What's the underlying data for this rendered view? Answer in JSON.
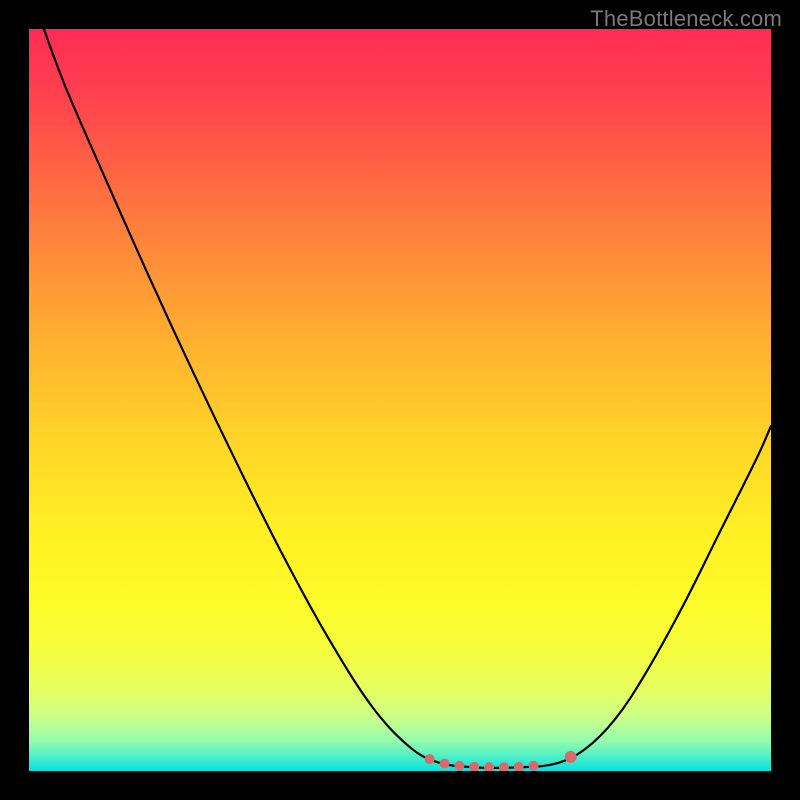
{
  "attribution": "TheBottleneck.com",
  "chart_data": {
    "type": "line",
    "title": "",
    "xlabel": "",
    "ylabel": "",
    "xlim": [
      0,
      100
    ],
    "ylim": [
      0,
      100
    ],
    "background": "gradient-red-yellow-green-vertical",
    "series": [
      {
        "name": "curve",
        "style": "black-thin-line",
        "points": [
          {
            "x": 2.0,
            "y": 100.0
          },
          {
            "x": 5.0,
            "y": 92.0
          },
          {
            "x": 10.0,
            "y": 80.5
          },
          {
            "x": 16.0,
            "y": 67.0
          },
          {
            "x": 22.0,
            "y": 54.0
          },
          {
            "x": 28.0,
            "y": 41.5
          },
          {
            "x": 34.0,
            "y": 29.5
          },
          {
            "x": 40.0,
            "y": 18.5
          },
          {
            "x": 46.0,
            "y": 9.0
          },
          {
            "x": 51.0,
            "y": 3.5
          },
          {
            "x": 55.0,
            "y": 1.2
          },
          {
            "x": 60.0,
            "y": 0.5
          },
          {
            "x": 66.0,
            "y": 0.5
          },
          {
            "x": 71.0,
            "y": 1.0
          },
          {
            "x": 75.0,
            "y": 3.0
          },
          {
            "x": 79.0,
            "y": 7.0
          },
          {
            "x": 83.0,
            "y": 13.0
          },
          {
            "x": 88.0,
            "y": 22.0
          },
          {
            "x": 93.0,
            "y": 32.0
          },
          {
            "x": 98.0,
            "y": 42.0
          },
          {
            "x": 100.0,
            "y": 46.5
          }
        ]
      },
      {
        "name": "markers",
        "style": "salmon-dots",
        "color": "#d86a6a",
        "points": [
          {
            "x": 54.0,
            "y": 1.6,
            "r": 5
          },
          {
            "x": 56.0,
            "y": 1.0,
            "r": 5
          },
          {
            "x": 58.0,
            "y": 0.7,
            "r": 5
          },
          {
            "x": 60.0,
            "y": 0.55,
            "r": 5
          },
          {
            "x": 62.0,
            "y": 0.5,
            "r": 5
          },
          {
            "x": 64.0,
            "y": 0.5,
            "r": 5
          },
          {
            "x": 66.0,
            "y": 0.55,
            "r": 5
          },
          {
            "x": 68.0,
            "y": 0.7,
            "r": 5
          },
          {
            "x": 73.0,
            "y": 1.9,
            "r": 6
          }
        ]
      }
    ]
  }
}
